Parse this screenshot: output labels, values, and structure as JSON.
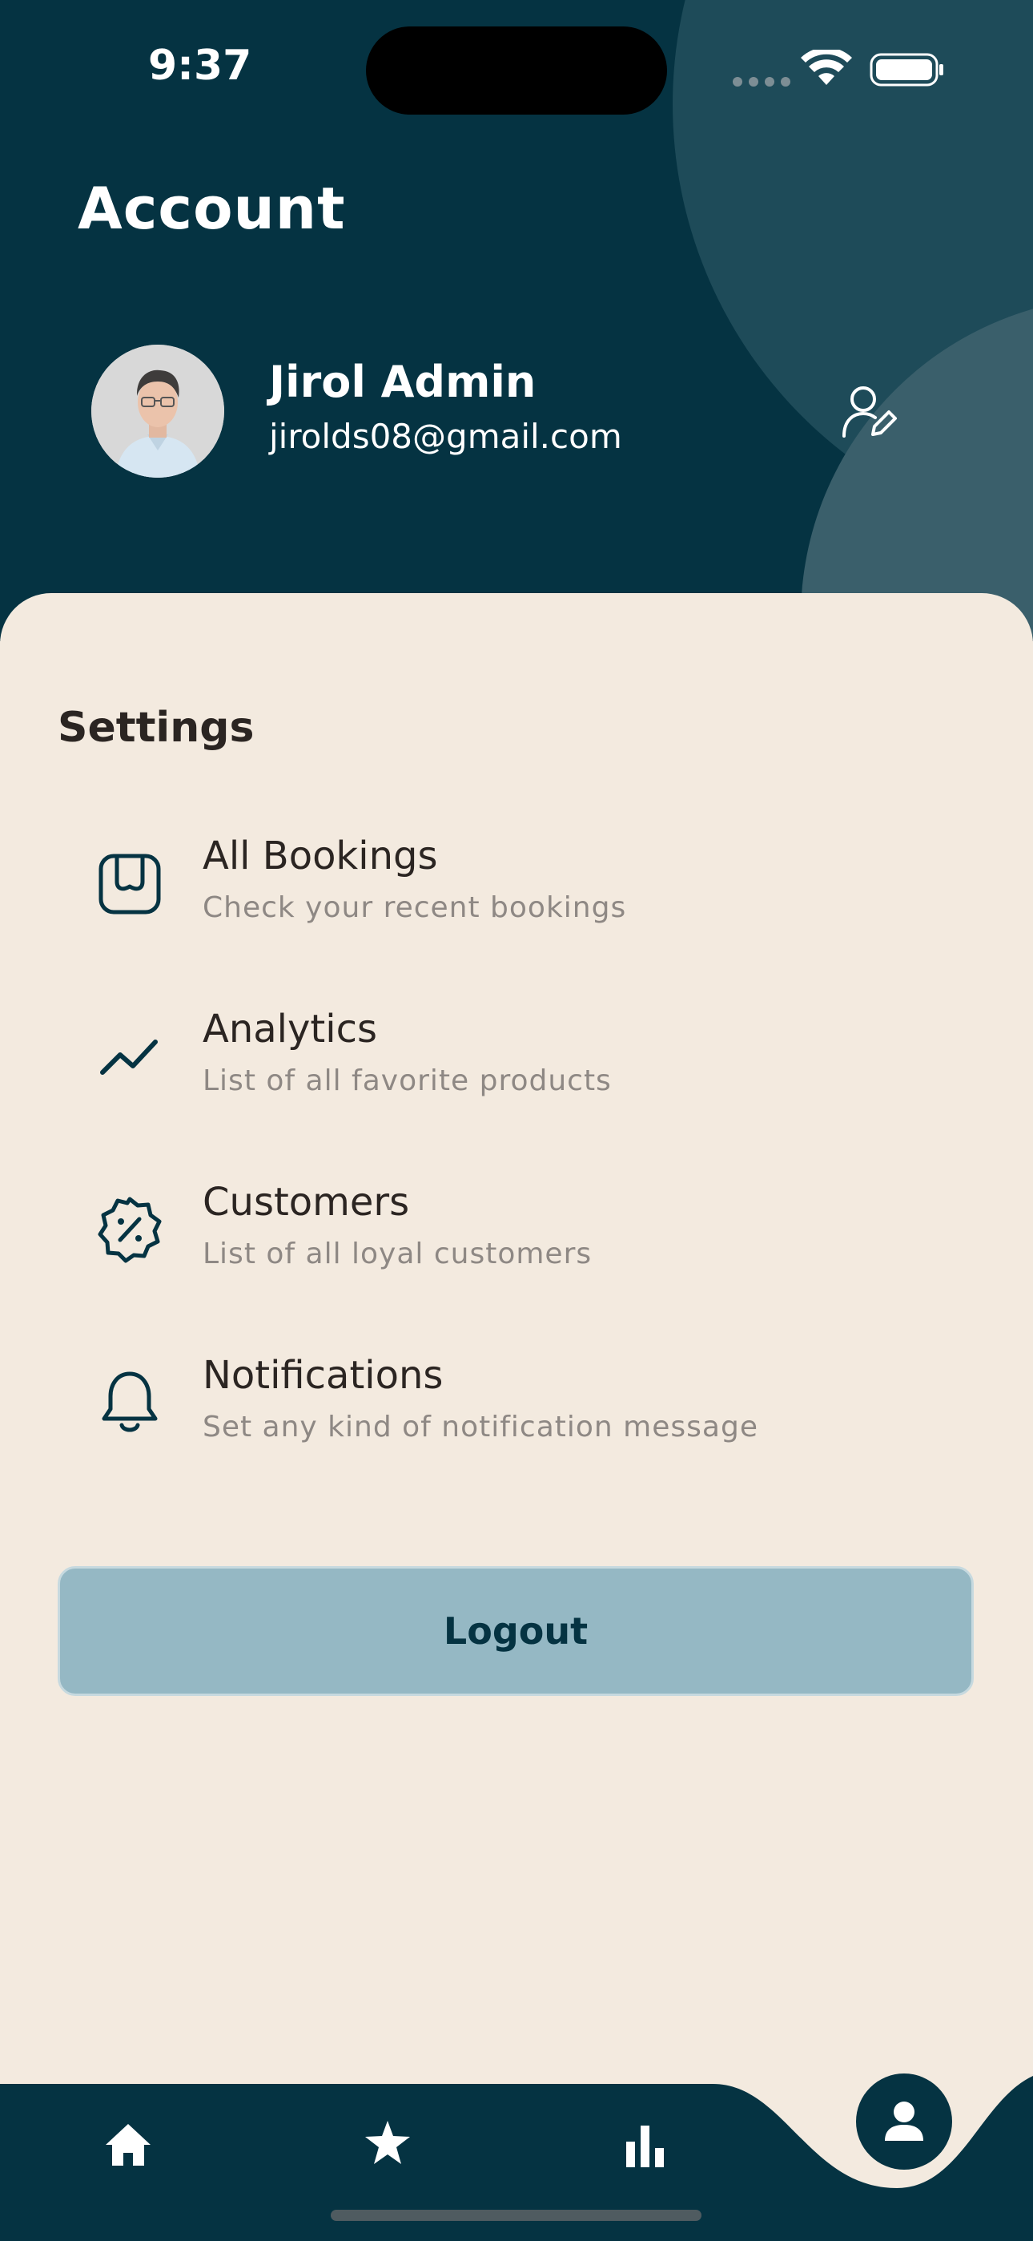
{
  "status_bar": {
    "time": "9:37"
  },
  "header": {
    "title": "Account",
    "user": {
      "name": "Jirol Admin",
      "email": "jirolds08@gmail.com"
    }
  },
  "settings": {
    "title": "Settings",
    "items": [
      {
        "label": "All Bookings",
        "subtitle": "Check your recent bookings",
        "icon": "bookings-icon"
      },
      {
        "label": "Analytics",
        "subtitle": "List of all favorite products",
        "icon": "trend-icon"
      },
      {
        "label": "Customers",
        "subtitle": "List of all loyal customers",
        "icon": "discount-badge-icon"
      },
      {
        "label": "Notifications",
        "subtitle": "Set any kind of notification message",
        "icon": "bell-icon"
      }
    ]
  },
  "logout": {
    "label": "Logout"
  },
  "bottom_nav": {
    "items": [
      "home-icon",
      "star-icon",
      "bar-chart-icon",
      "person-icon"
    ],
    "active": "person-icon"
  },
  "colors": {
    "primary": "#053342",
    "background": "#F3EADF",
    "logout_button": "#95B8C4"
  }
}
